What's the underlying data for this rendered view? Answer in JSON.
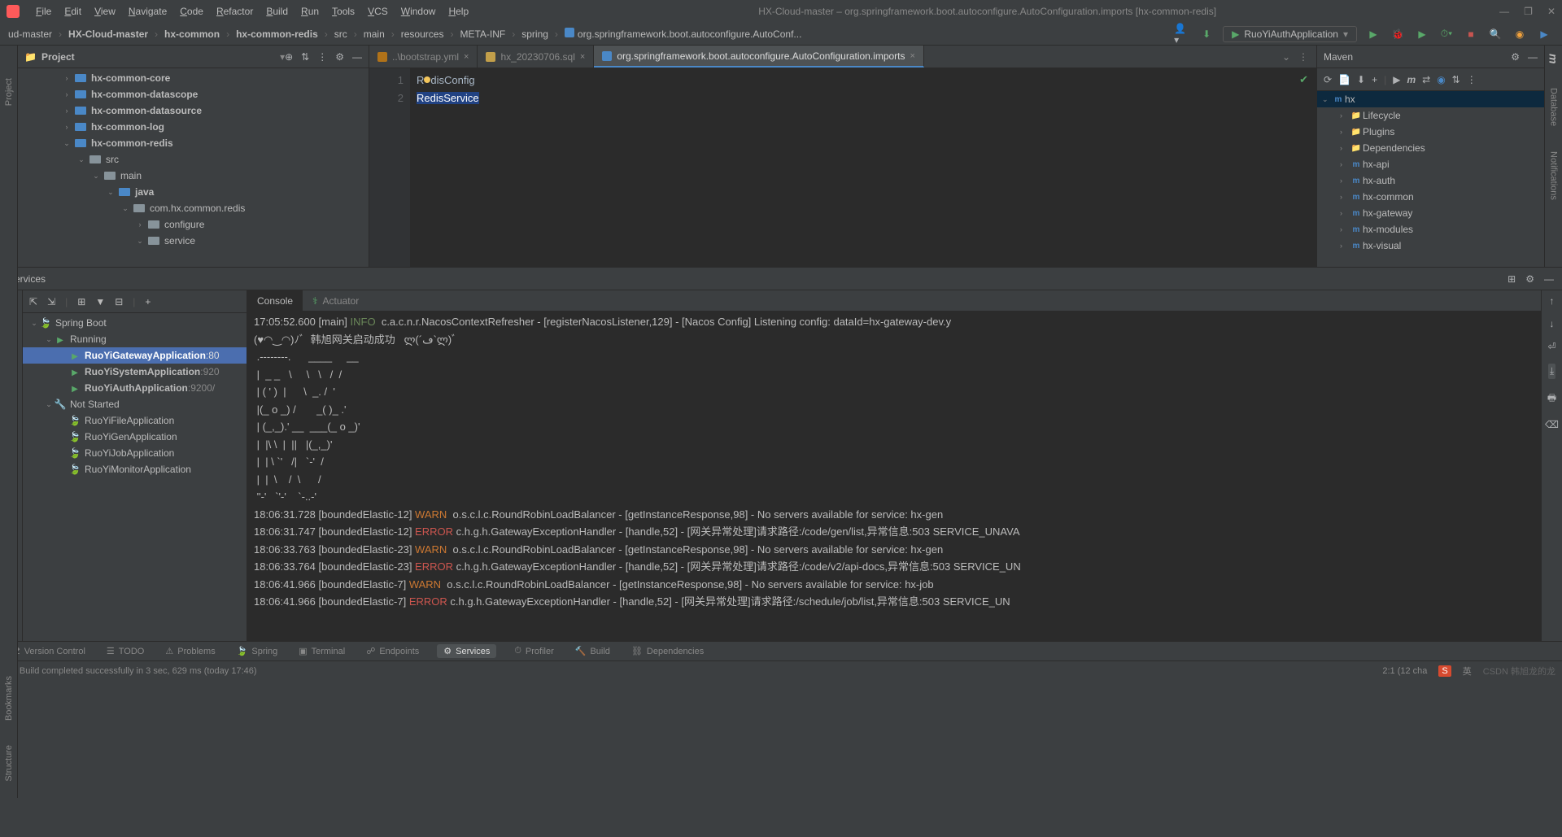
{
  "window": {
    "title": "HX-Cloud-master – org.springframework.boot.autoconfigure.AutoConfiguration.imports [hx-common-redis]"
  },
  "menu": [
    "File",
    "Edit",
    "View",
    "Navigate",
    "Code",
    "Refactor",
    "Build",
    "Run",
    "Tools",
    "VCS",
    "Window",
    "Help"
  ],
  "breadcrumbs": [
    "ud-master",
    "HX-Cloud-master",
    "hx-common",
    "hx-common-redis",
    "src",
    "main",
    "resources",
    "META-INF",
    "spring",
    "org.springframework.boot.autoconfigure.AutoConf..."
  ],
  "run_config": "RuoYiAuthApplication",
  "project_panel": {
    "title": "Project",
    "tree": [
      {
        "indent": 3,
        "arrow": "›",
        "icon": "folder-blue",
        "label": "hx-common-core"
      },
      {
        "indent": 3,
        "arrow": "›",
        "icon": "folder-blue",
        "label": "hx-common-datascope"
      },
      {
        "indent": 3,
        "arrow": "›",
        "icon": "folder-blue",
        "label": "hx-common-datasource"
      },
      {
        "indent": 3,
        "arrow": "›",
        "icon": "folder-blue",
        "label": "hx-common-log"
      },
      {
        "indent": 3,
        "arrow": "⌄",
        "icon": "folder-blue",
        "label": "hx-common-redis"
      },
      {
        "indent": 4,
        "arrow": "⌄",
        "icon": "folder",
        "label": "src"
      },
      {
        "indent": 5,
        "arrow": "⌄",
        "icon": "folder",
        "label": "main"
      },
      {
        "indent": 6,
        "arrow": "⌄",
        "icon": "folder-blue",
        "label": "java"
      },
      {
        "indent": 7,
        "arrow": "⌄",
        "icon": "folder",
        "label": "com.hx.common.redis"
      },
      {
        "indent": 8,
        "arrow": "›",
        "icon": "folder",
        "label": "configure"
      },
      {
        "indent": 8,
        "arrow": "⌄",
        "icon": "folder",
        "label": "service"
      }
    ]
  },
  "editor_tabs": [
    {
      "label": "..\\bootstrap.yml",
      "icon": "yml",
      "active": false,
      "close": true
    },
    {
      "label": "hx_20230706.sql",
      "icon": "sql",
      "active": false,
      "close": true
    },
    {
      "label": "org.springframework.boot.autoconfigure.AutoConfiguration.imports",
      "icon": "file",
      "active": true,
      "close": true
    }
  ],
  "code": {
    "line1_pre": "R",
    "line1_post": "disConfig",
    "line2": "RedisService"
  },
  "maven": {
    "title": "Maven",
    "root": "hx",
    "items": [
      "Lifecycle",
      "Plugins",
      "Dependencies",
      "hx-api",
      "hx-auth",
      "hx-common",
      "hx-gateway",
      "hx-modules",
      "hx-visual"
    ]
  },
  "services": {
    "title": "Services",
    "console_tab": "Console",
    "actuator_tab": "Actuator",
    "tree": {
      "root": "Spring Boot",
      "running": "Running",
      "running_items": [
        {
          "label": "RuoYiGatewayApplication",
          "port": ":80",
          "selected": true
        },
        {
          "label": "RuoYiSystemApplication",
          "port": ":920"
        },
        {
          "label": "RuoYiAuthApplication",
          "port": ":9200/"
        }
      ],
      "not_started": "Not Started",
      "ns_items": [
        "RuoYiFileApplication",
        "RuoYiGenApplication",
        "RuoYiJobApplication",
        "RuoYiMonitorApplication"
      ]
    },
    "console_lines": [
      {
        "t": "17:05:52.600 [main] ",
        "lvl": "INFO",
        "rest": "  c.a.c.n.r.NacosContextRefresher - [registerNacosListener,129] - [Nacos Config] Listening config: dataId=hx-gateway-dev.y"
      },
      {
        "raw": "(♥◠‿◠)ﾉﾞ  韩旭网关启动成功   ლ(´ڡ`ლ)ﾞ"
      },
      {
        "raw": " .--------.      ____     __"
      },
      {
        "raw": " |  _ _   \\     \\   \\   /  /"
      },
      {
        "raw": " | ( ' )  |      \\  _. /  '"
      },
      {
        "raw": " |(_ o _) /       _( )_ .'"
      },
      {
        "raw": " | (_,_).' __  ___(_ o _)'"
      },
      {
        "raw": " |  |\\ \\  |  ||   |(_,_)'"
      },
      {
        "raw": " |  | \\ `'   /|   `-'  /"
      },
      {
        "raw": " |  |  \\    /  \\      /"
      },
      {
        "raw": " ''-'   `'-'    `-..-'"
      },
      {
        "t": "18:06:31.728 [boundedElastic-12] ",
        "lvl": "WARN",
        "rest": "  o.s.c.l.c.RoundRobinLoadBalancer - [getInstanceResponse,98] - No servers available for service: hx-gen"
      },
      {
        "t": "18:06:31.747 [boundedElastic-12] ",
        "lvl": "ERROR",
        "rest": " c.h.g.h.GatewayExceptionHandler - [handle,52] - [网关异常处理]请求路径:/code/gen/list,异常信息:503 SERVICE_UNAVA"
      },
      {
        "t": "18:06:33.763 [boundedElastic-23] ",
        "lvl": "WARN",
        "rest": "  o.s.c.l.c.RoundRobinLoadBalancer - [getInstanceResponse,98] - No servers available for service: hx-gen"
      },
      {
        "t": "18:06:33.764 [boundedElastic-23] ",
        "lvl": "ERROR",
        "rest": " c.h.g.h.GatewayExceptionHandler - [handle,52] - [网关异常处理]请求路径:/code/v2/api-docs,异常信息:503 SERVICE_UN"
      },
      {
        "t": "18:06:41.966 [boundedElastic-7] ",
        "lvl": "WARN",
        "rest": "  o.s.c.l.c.RoundRobinLoadBalancer - [getInstanceResponse,98] - No servers available for service: hx-job"
      },
      {
        "t": "18:06:41.966 [boundedElastic-7] ",
        "lvl": "ERROR",
        "rest": " c.h.g.h.GatewayExceptionHandler - [handle,52] - [网关异常处理]请求路径:/schedule/job/list,异常信息:503 SERVICE_UN"
      }
    ]
  },
  "bottom_tabs": [
    "Version Control",
    "TODO",
    "Problems",
    "Spring",
    "Terminal",
    "Endpoints",
    "Services",
    "Profiler",
    "Build",
    "Dependencies"
  ],
  "status": {
    "msg": "Build completed successfully in 3 sec, 629 ms (today 17:46)",
    "pos": "2:1 (12 cha"
  },
  "side_labels": {
    "project": "Project",
    "bookmarks": "Bookmarks",
    "structure": "Structure",
    "maven": "Maven",
    "database": "Database",
    "notifications": "Notifications"
  }
}
